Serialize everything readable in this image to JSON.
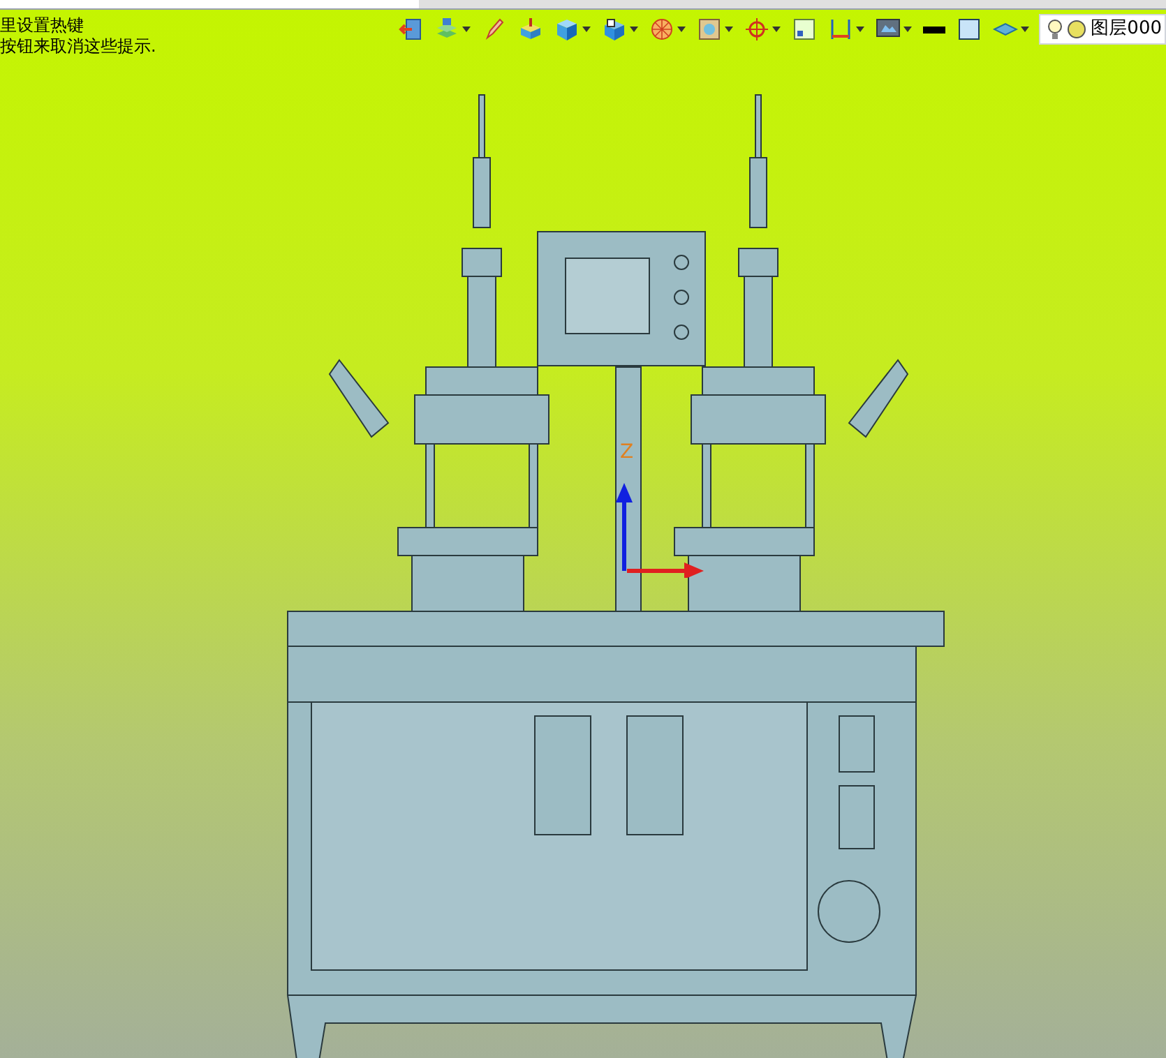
{
  "hint_lines": [
    "里设置热键",
    "按钮来取消这些提示."
  ],
  "layer": {
    "name": "图层000"
  },
  "axis": {
    "z_label": "Z"
  }
}
